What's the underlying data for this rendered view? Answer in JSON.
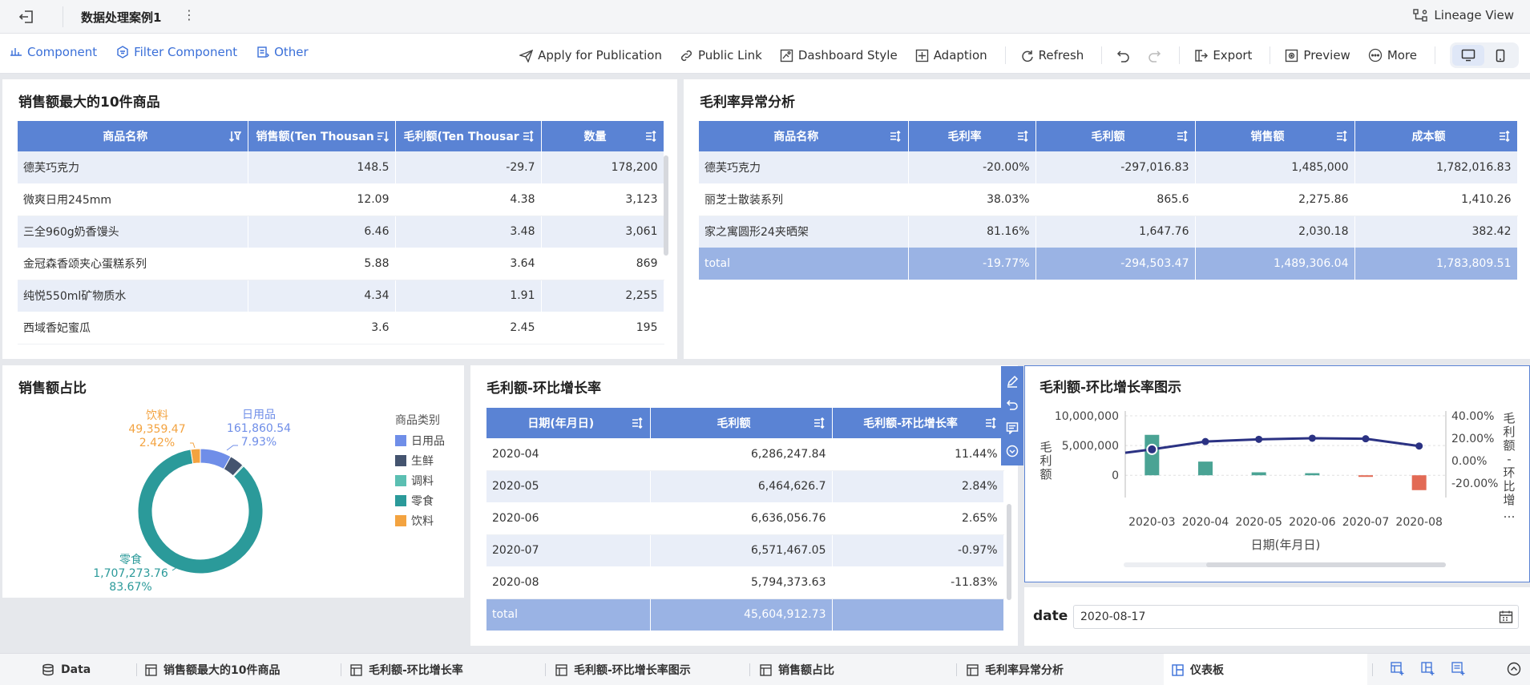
{
  "topbar": {
    "title": "数据处理案例1",
    "lineage": "Lineage View"
  },
  "toolbar": {
    "left": [
      "Component",
      "Filter Component",
      "Other"
    ],
    "apply": "Apply for Publication",
    "public_link": "Public Link",
    "dashboard_style": "Dashboard Style",
    "adaption": "Adaption",
    "refresh": "Refresh",
    "export": "Export",
    "preview": "Preview",
    "more": "More"
  },
  "top10": {
    "title": "销售额最大的10件商品",
    "headers": [
      "商品名称",
      "销售额(Ten Thousan",
      "毛利额(Ten Thousar",
      "数量"
    ],
    "rows": [
      [
        "德芙巧克力",
        "148.5",
        "-29.7",
        "178,200"
      ],
      [
        "微爽日用245mm",
        "12.09",
        "4.38",
        "3,123"
      ],
      [
        "三全960g奶香馒头",
        "6.46",
        "3.48",
        "3,061"
      ],
      [
        "金冠森香颂夹心蛋糕系列",
        "5.88",
        "3.64",
        "869"
      ],
      [
        "纯悦550ml矿物质水",
        "4.34",
        "1.91",
        "2,255"
      ],
      [
        "西域香妃蜜瓜",
        "3.6",
        "2.45",
        "195"
      ]
    ]
  },
  "margin": {
    "title": "毛利率异常分析",
    "headers": [
      "商品名称",
      "毛利率",
      "毛利额",
      "销售额",
      "成本额"
    ],
    "rows": [
      [
        "德芙巧克力",
        "-20.00%",
        "-297,016.83",
        "1,485,000",
        "1,782,016.83"
      ],
      [
        "丽芝士散装系列",
        "38.03%",
        "865.6",
        "2,275.86",
        "1,410.26"
      ],
      [
        "家之寓圆形24夹晒架",
        "81.16%",
        "1,647.76",
        "2,030.18",
        "382.42"
      ]
    ],
    "total": [
      "total",
      "-19.77%",
      "-294,503.47",
      "1,489,306.04",
      "1,783,809.51"
    ]
  },
  "share": {
    "title": "销售额占比",
    "legend_title": "商品类别",
    "label_riyong": [
      "日用品",
      "161,860.54",
      "7.93%"
    ],
    "label_yinliao": [
      "饮料",
      "49,359.47",
      "2.42%"
    ],
    "label_lingshi": [
      "零食",
      "1,707,273.76",
      "83.67%"
    ],
    "slices": [
      {
        "name": "日用品",
        "value": 161860.54,
        "color": "#6f8ee8"
      },
      {
        "name": "生鲜",
        "value": 75500,
        "color": "#44546f"
      },
      {
        "name": "调料",
        "value": 6200,
        "color": "#5bbfb2"
      },
      {
        "name": "零食",
        "value": 1707273.76,
        "color": "#2b9a9a"
      },
      {
        "name": "饮料",
        "value": 49359.47,
        "color": "#f3a340"
      }
    ]
  },
  "growth": {
    "title": "毛利额-环比增长率",
    "headers": [
      "日期(年月日)",
      "毛利额",
      "毛利额-环比增长率"
    ],
    "rows": [
      [
        "2020-04",
        "6,286,247.84",
        "11.44%"
      ],
      [
        "2020-05",
        "6,464,626.7",
        "2.84%"
      ],
      [
        "2020-06",
        "6,636,056.76",
        "2.65%"
      ],
      [
        "2020-07",
        "6,571,467.05",
        "-0.97%"
      ],
      [
        "2020-08",
        "5,794,373.63",
        "-11.83%"
      ]
    ],
    "total": [
      "total",
      "45,604,912.73",
      ""
    ]
  },
  "chart_data": {
    "type": "bar",
    "title": "毛利额-环比增长率图示",
    "xlabel": "日期(年月日)",
    "ylabel": "毛利额",
    "y2label": "毛利额-环比增长率",
    "categories": [
      "2020-03",
      "2020-04",
      "2020-05",
      "2020-06",
      "2020-07",
      "2020-08"
    ],
    "yticks": [
      "10,000,000",
      "5,000,000",
      "0"
    ],
    "y2ticks": [
      "40.00%",
      "20.00%",
      "0.00%",
      "-20.00%"
    ],
    "ylim": [
      -2800000,
      10000000
    ],
    "y2lim": [
      -28,
      40
    ],
    "series": [
      {
        "type": "bar",
        "values": [
          6800000,
          2300000,
          500000,
          350000,
          -120000,
          -2500000
        ],
        "colors": [
          "#4aa394",
          "#4aa394",
          "#4aa394",
          "#4aa394",
          "#e26a55",
          "#e26a55"
        ]
      },
      {
        "type": "line",
        "values": [
          10,
          17,
          19,
          20,
          19.5,
          13
        ],
        "color": "#2b3283"
      }
    ]
  },
  "filter": {
    "label": "date",
    "value": "2020-08-17"
  },
  "bottom": {
    "data": "Data",
    "tabs": [
      "销售额最大的10件商品",
      "毛利额-环比增长率",
      "毛利额-环比增长率图示",
      "销售额占比",
      "毛利率异常分析",
      "仪表板"
    ]
  }
}
